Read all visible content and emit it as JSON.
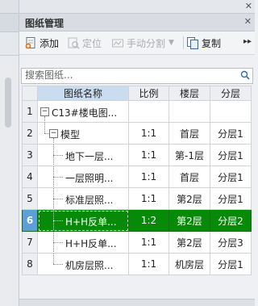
{
  "panel": {
    "title": "图纸管理"
  },
  "toolbar": {
    "add_label": "添加",
    "locate_label": "定位",
    "split_label": "手动分割",
    "copy_label": "复制"
  },
  "search": {
    "placeholder": "搜索图纸..."
  },
  "table": {
    "headers": {
      "name": "图纸名称",
      "scale": "比例",
      "floor": "楼层",
      "layer": "分层"
    },
    "rows": [
      {
        "num": "1",
        "name": "C13#楼电图...",
        "scale": "",
        "floor": "",
        "layer": ""
      },
      {
        "num": "2",
        "name": "模型",
        "scale": "1:1",
        "floor": "首层",
        "layer": "分层1"
      },
      {
        "num": "3",
        "name": "地下一层...",
        "scale": "1:1",
        "floor": "第-1层",
        "layer": "分层1"
      },
      {
        "num": "4",
        "name": "一层照明...",
        "scale": "1:1",
        "floor": "首层",
        "layer": "分层1"
      },
      {
        "num": "5",
        "name": "标准层照...",
        "scale": "1:1",
        "floor": "第2层",
        "layer": "分层1"
      },
      {
        "num": "6",
        "name": "H+H反单...",
        "scale": "1:2",
        "floor": "第2层",
        "layer": "分层2"
      },
      {
        "num": "7",
        "name": "H+H反单...",
        "scale": "1:1",
        "floor": "第2层",
        "layer": "分层3"
      },
      {
        "num": "8",
        "name": "机房层照...",
        "scale": "1:1",
        "floor": "机房层",
        "layer": "分层1"
      }
    ],
    "selected_row": "6"
  },
  "colors": {
    "selected_row": "#078a07",
    "selected_rownum": "#5d9fd8",
    "header_highlight": "#c9dcf0"
  }
}
